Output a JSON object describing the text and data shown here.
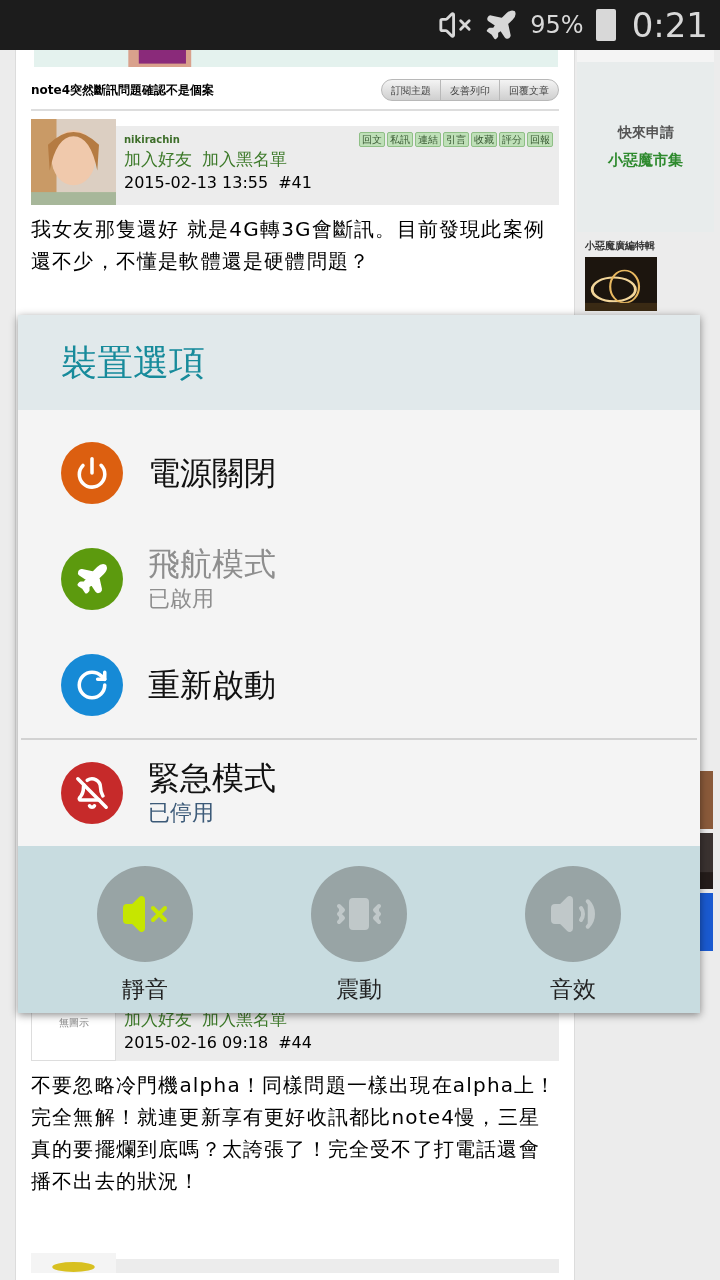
{
  "status_bar": {
    "battery": "95%",
    "time": "0:21"
  },
  "thread": {
    "title": "note4突然斷訊問題確認不是個案",
    "buttons": [
      "訂閱主題",
      "友善列印",
      "回覆文章"
    ]
  },
  "posts": [
    {
      "username": "nikirachin",
      "links": [
        "加入好友",
        "加入黑名單"
      ],
      "date": "2015-02-13 13:55",
      "number": "#41",
      "actions": [
        "回文",
        "私訊",
        "連結",
        "引言",
        "收藏",
        "評分",
        "回報"
      ],
      "body": "我女友那隻還好 就是4G轉3G會斷訊。目前發現此案例還不少，不懂是軟體還是硬體問題？"
    },
    {
      "avatar_text": "無圖示",
      "links": [
        "加入好友",
        "加入黑名單"
      ],
      "date": "2015-02-16 09:18",
      "number": "#44",
      "body": "不要忽略冷門機alpha！同樣問題一樣出現在alpha上！完全無解！就連更新享有更好收訊都比note4慢，三星真的要擺爛到底嗎？太誇張了！完全受不了打電話還會播不出去的狀況！"
    }
  ],
  "sidebar": {
    "promo_lines": [
      "快來申請",
      "小惡魔市集"
    ],
    "section_title": "小惡魔廣編特輯"
  },
  "dialog": {
    "title": "裝置選項",
    "options": [
      {
        "kind": "power",
        "label": "電源關閉",
        "disabled": false
      },
      {
        "kind": "airplane",
        "label": "飛航模式",
        "subtitle": "已啟用",
        "disabled": true
      },
      {
        "kind": "restart",
        "label": "重新啟動",
        "disabled": false
      },
      {
        "kind": "emergency",
        "label": "緊急模式",
        "subtitle": "已停用",
        "disabled": false
      }
    ],
    "sound_modes": [
      {
        "kind": "mute",
        "label": "靜音",
        "selected": true
      },
      {
        "kind": "vibrate",
        "label": "震動",
        "selected": false
      },
      {
        "kind": "sound",
        "label": "音效",
        "selected": false
      }
    ]
  }
}
